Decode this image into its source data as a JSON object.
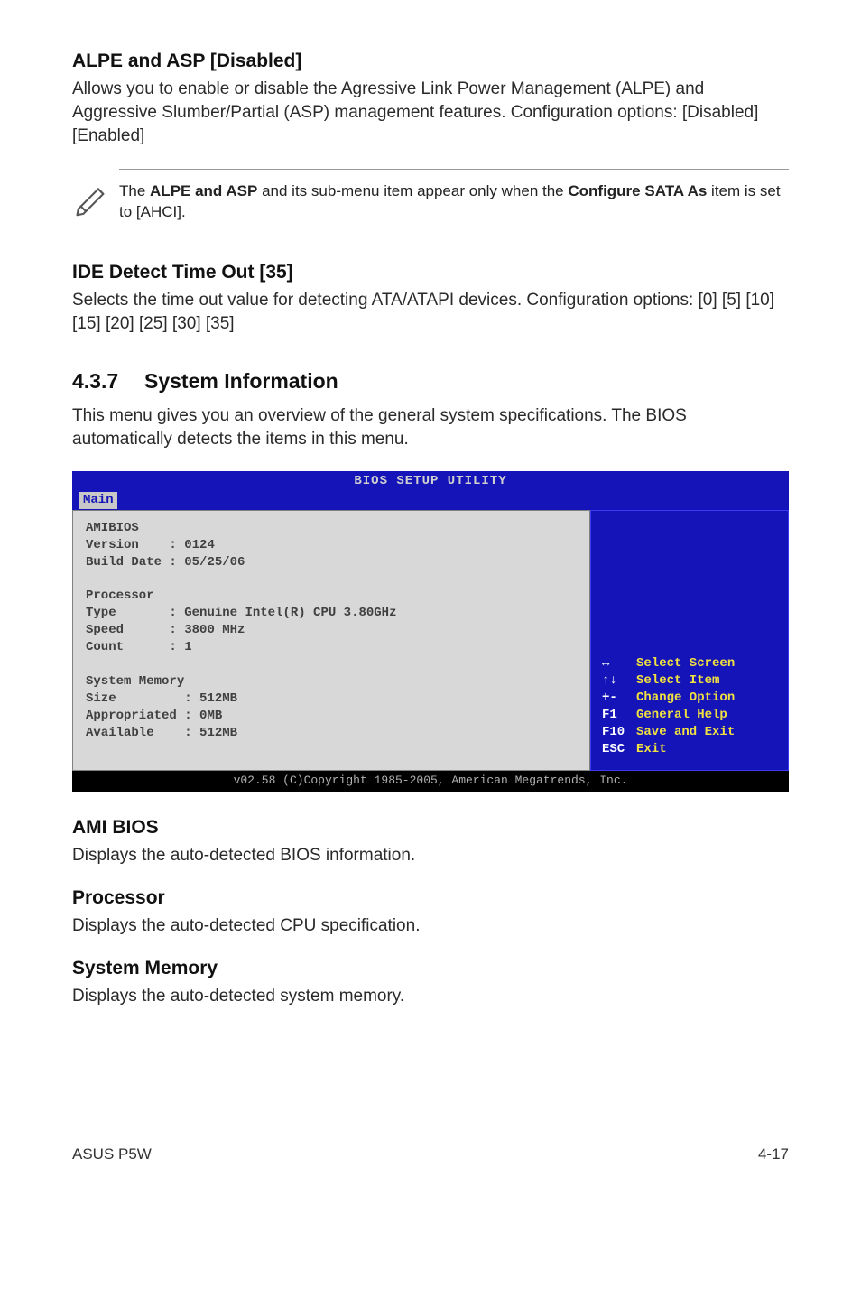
{
  "section1": {
    "title": "ALPE and ASP [Disabled]",
    "body": "Allows you to enable or disable the Agressive Link Power Management (ALPE) and Aggressive Slumber/Partial (ASP) management features. Configuration options: [Disabled] [Enabled]"
  },
  "note": {
    "part1": "The ",
    "bold1": "ALPE and ASP",
    "part2": " and its sub-menu item appear only when the ",
    "bold2": "Configure SATA As",
    "part3": " item is set to [AHCI]."
  },
  "section2": {
    "title": "IDE Detect Time Out [35]",
    "body": "Selects the time out value for detecting ATA/ATAPI devices. Configuration options: [0] [5] [10] [15] [20] [25] [30] [35]"
  },
  "mainsection": {
    "num": "4.3.7",
    "name": "System Information",
    "intro": "This menu gives you an overview of the general system specifications. The BIOS automatically detects the items in this menu."
  },
  "bios": {
    "title": "BIOS SETUP UTILITY",
    "tab": "Main",
    "amibios_label": "AMIBIOS",
    "version_label": "Version",
    "version_value": "0124",
    "builddate_label": "Build Date",
    "builddate_value": "05/25/06",
    "processor_label": "Processor",
    "type_label": "Type",
    "type_value": "Genuine Intel(R) CPU 3.80GHz",
    "speed_label": "Speed",
    "speed_value": "3800 MHz",
    "count_label": "Count",
    "count_value": "1",
    "sysmem_label": "System Memory",
    "size_label": "Size",
    "size_value": "512MB",
    "appr_label": "Appropriated",
    "appr_value": "0MB",
    "avail_label": "Available",
    "avail_value": "512MB",
    "hints": [
      {
        "key": "↔",
        "label": "Select Screen"
      },
      {
        "key": "↑↓",
        "label": "Select Item"
      },
      {
        "key": "+-",
        "label": "Change Option"
      },
      {
        "key": "F1",
        "label": "General Help"
      },
      {
        "key": "F10",
        "label": "Save and Exit"
      },
      {
        "key": "ESC",
        "label": "Exit"
      }
    ],
    "footer": "v02.58 (C)Copyright 1985-2005, American Megatrends, Inc."
  },
  "sub1": {
    "title": "AMI BIOS",
    "body": "Displays the auto-detected BIOS information."
  },
  "sub2": {
    "title": "Processor",
    "body": "Displays the auto-detected CPU specification."
  },
  "sub3": {
    "title": "System Memory",
    "body": "Displays the auto-detected system memory."
  },
  "pagefooter": {
    "left": "ASUS P5W",
    "right": "4-17"
  }
}
